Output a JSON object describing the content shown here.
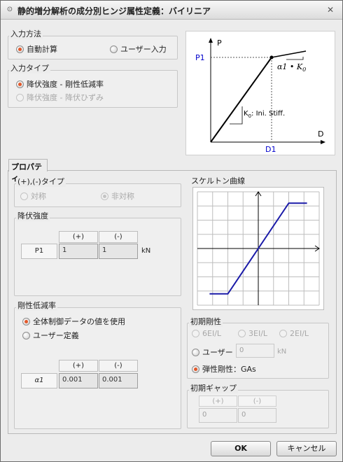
{
  "window": {
    "title": "静的増分解析の成分別ヒンジ属性定義：バイリニア",
    "close_glyph": "✕"
  },
  "input_method": {
    "label": "入力方法",
    "auto": "自動計算",
    "user": "ユーザー入力",
    "selected": "auto"
  },
  "input_type": {
    "label": "入力タイプ",
    "option1": "降伏強度 - 剛性低減率",
    "option2": "降伏強度 - 降伏ひずみ",
    "selected": "option1"
  },
  "diagram": {
    "p_axis": "P",
    "d_axis": "D",
    "p1": "P1",
    "d1": "D1",
    "alpha_label": "α1 • K",
    "alpha_sub": "0",
    "k0_label": "K",
    "k0_sub": "0",
    "k0_text": ": Ini. Stiff.",
    "accent_color": "#0000cc"
  },
  "tab": {
    "label": "プロパティ"
  },
  "sign_type": {
    "label": "(+),(-)タイプ",
    "symmetric": "対称",
    "asymmetric": "非対称",
    "selected": "asymmetric"
  },
  "yield_strength": {
    "label": "降伏強度",
    "col_plus": "(+)",
    "col_minus": "(-)",
    "row_label": "P1",
    "value_plus": "1",
    "value_minus": "1",
    "unit": "kN"
  },
  "stiffness_reduction": {
    "label": "剛性低減率",
    "option_global": "全体制御データの値を使用",
    "option_user": "ユーザー定義",
    "selected": "option_global",
    "col_plus": "(+)",
    "col_minus": "(-)",
    "row_label": "α1",
    "value_plus": "0.001",
    "value_minus": "0.001"
  },
  "skeleton": {
    "label": "スケルトン曲線",
    "line_color": "#1a1aa8",
    "points": [
      [
        -4,
        -1
      ],
      [
        -2.5,
        -1
      ],
      [
        2.5,
        1
      ],
      [
        4,
        1
      ]
    ],
    "x_range": [
      -5,
      5
    ],
    "y_range": [
      -1.25,
      1.25
    ]
  },
  "initial_stiffness": {
    "label": "初期剛性",
    "opt_6ei": "6EI/L",
    "opt_3ei": "3EI/L",
    "opt_2ei": "2EI/L",
    "opt_user": "ユーザー",
    "user_value": "0",
    "unit": "kN",
    "opt_elastic": "弾性剛性：GAs",
    "selected": "opt_elastic"
  },
  "initial_gap": {
    "label": "初期ギャップ",
    "col_plus": "(+)",
    "col_minus": "(-)",
    "value_plus": "0",
    "value_minus": "0"
  },
  "buttons": {
    "ok": "OK",
    "cancel": "キャンセル"
  }
}
